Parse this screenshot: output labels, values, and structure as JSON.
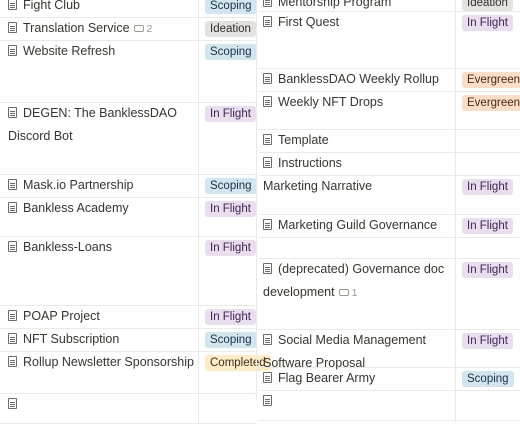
{
  "colors": {
    "Scoping": {
      "bg": "#d3e5ef",
      "fg": "#183347"
    },
    "Ideation": {
      "bg": "#e3e2e0",
      "fg": "#32302c"
    },
    "In Flight": {
      "bg": "#e8deee",
      "fg": "#412454"
    },
    "Evergreen": {
      "bg": "#fadec9",
      "fg": "#49290e"
    },
    "Completed": {
      "bg": "#fdecc8",
      "fg": "#402c1b"
    }
  },
  "left_rows": [
    {
      "title": "Fight Club",
      "tag": "Scoping",
      "icon": "doc-icon"
    },
    {
      "title": "Translation Service",
      "tag": "Ideation",
      "icon": "doc-icon",
      "comments": "2"
    },
    {
      "title": "Website Refresh",
      "tag": "Scoping",
      "icon": "doc-icon"
    },
    {
      "title": "DEGEN: The BanklessDAO Discord Bot",
      "tag": "In Flight",
      "icon": "doc-icon"
    },
    {
      "title": "Mask.io Partnership",
      "tag": "Scoping",
      "icon": "doc-icon"
    },
    {
      "title": "Bankless Academy",
      "tag": "In Flight",
      "icon": "doc-icon"
    },
    {
      "title": "Bankless-Loans",
      "tag": "In Flight",
      "icon": "doc-icon"
    },
    {
      "title": "POAP Project",
      "tag": "In Flight",
      "icon": "doc-icon"
    },
    {
      "title": "NFT Subscription",
      "tag": "Scoping",
      "icon": "doc-icon"
    },
    {
      "title": "Rollup Newsletter Sponsorship",
      "tag": "Completed",
      "icon": "doc-icon"
    },
    {
      "title": "",
      "tag": "",
      "icon": "doc-icon"
    }
  ],
  "right_rows": [
    {
      "title": "Mentorship Program",
      "tag": "Ideation",
      "icon": "doc-icon"
    },
    {
      "title": "First Quest",
      "tag": "In Flight",
      "icon": "doc-icon"
    },
    {
      "title": "BanklessDAO Weekly Rollup",
      "tag": "Evergreen",
      "icon": "doc-icon"
    },
    {
      "title": "Weekly NFT Drops",
      "tag": "Evergreen",
      "icon": "doc-icon"
    },
    {
      "title": "Template",
      "tag": "",
      "icon": "doc-icon"
    },
    {
      "title": "Instructions",
      "tag": "",
      "icon": "doc-icon"
    },
    {
      "title": "Marketing Narrative",
      "tag": "In Flight",
      "icon": ""
    },
    {
      "title": "Marketing Guild Governance",
      "tag": "In Flight",
      "icon": "doc-icon"
    },
    {
      "title": "",
      "tag": "",
      "icon": ""
    },
    {
      "title": "(deprecated) Governance doc development",
      "tag": "In Flight",
      "icon": "doc-icon",
      "comments": "1"
    },
    {
      "title": "Social Media Management Software Proposal",
      "tag": "In Flight",
      "icon": "doc-icon"
    },
    {
      "title": "Flag Bearer Army",
      "tag": "Scoping",
      "icon": "doc-icon"
    },
    {
      "title": "",
      "tag": "",
      "icon": "doc-icon"
    }
  ]
}
